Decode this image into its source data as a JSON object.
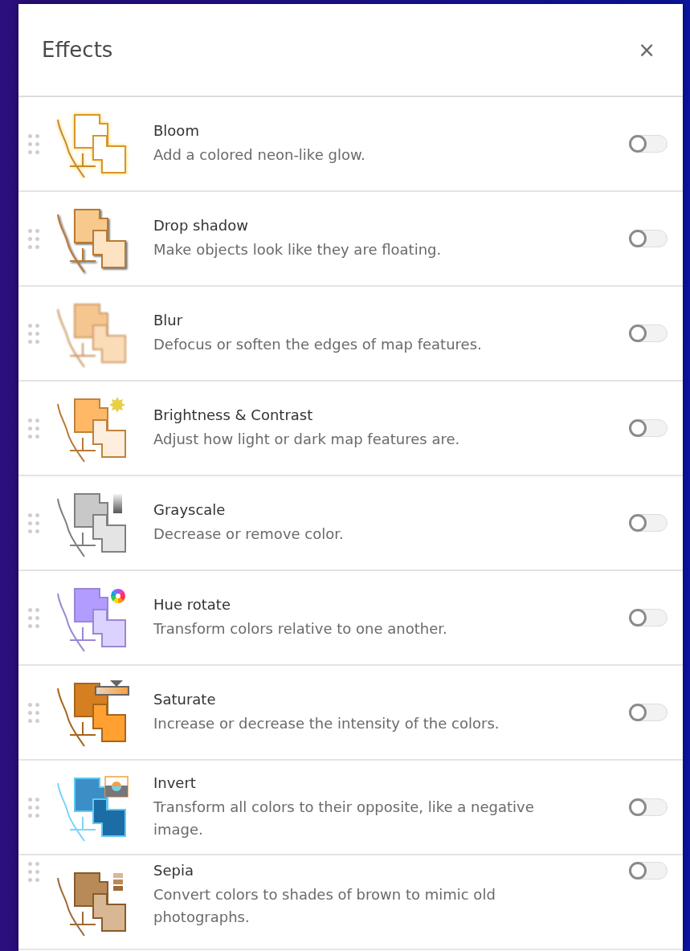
{
  "panel": {
    "title": "Effects",
    "close": "×"
  },
  "effects": [
    {
      "kind": "bloom",
      "title": "Bloom",
      "description": "Add a colored neon-like glow.",
      "on": false
    },
    {
      "kind": "drop-shadow",
      "title": "Drop shadow",
      "description": "Make objects look like they are floating.",
      "on": false
    },
    {
      "kind": "blur",
      "title": "Blur",
      "description": "Defocus or soften the edges of map features.",
      "on": false
    },
    {
      "kind": "brightness",
      "title": "Brightness & Contrast",
      "description": "Adjust how light or dark map features are.",
      "on": false
    },
    {
      "kind": "grayscale",
      "title": "Grayscale",
      "description": "Decrease or remove color.",
      "on": false
    },
    {
      "kind": "hue-rotate",
      "title": "Hue rotate",
      "description": "Transform colors relative to one another.",
      "on": false
    },
    {
      "kind": "saturate",
      "title": "Saturate",
      "description": "Increase or decrease the intensity of the colors.",
      "on": false
    },
    {
      "kind": "invert",
      "title": "Invert",
      "description": "Transform all colors to their opposite, like a negative image.",
      "on": false
    },
    {
      "kind": "sepia",
      "title": "Sepia",
      "description": "Convert colors to shades of brown to mimic old photographs.",
      "on": false
    }
  ]
}
